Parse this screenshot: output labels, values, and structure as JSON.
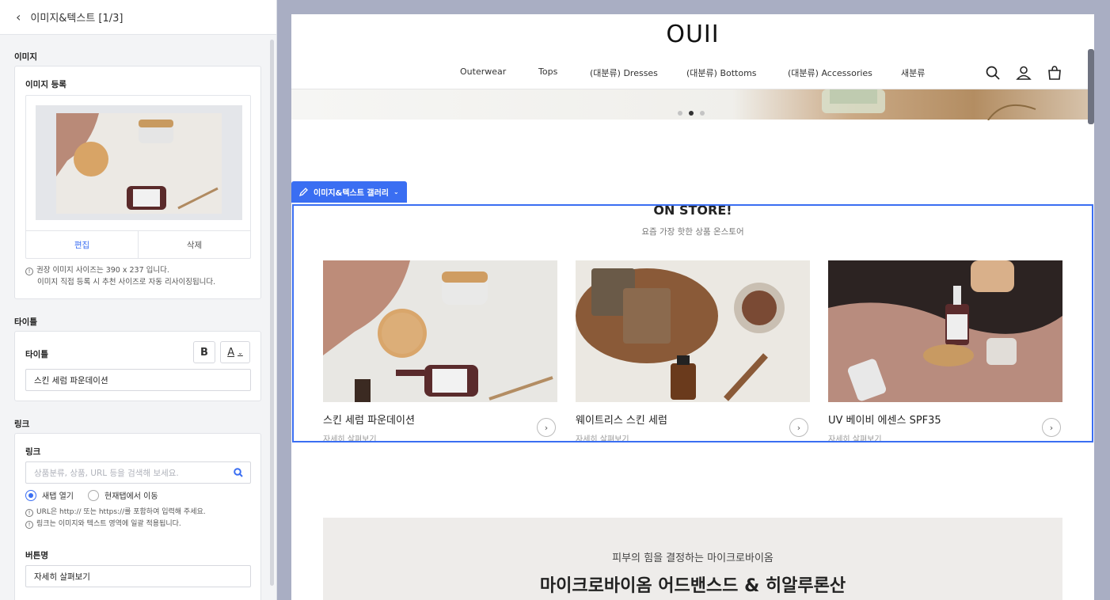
{
  "panel": {
    "header_title": "이미지&텍스트 [1/3]",
    "image_section": "이미지",
    "image_card_label": "이미지 등록",
    "edit_label": "편집",
    "delete_label": "삭제",
    "image_note_1": "권장 이미지 사이즈는 390 x 237 입니다.",
    "image_note_2": "이미지 직접 등록 시 추천 사이즈로 자동 리사이징됩니다.",
    "title_section": "타이틀",
    "title_card_label": "타이틀",
    "bold_label": "B",
    "color_label": "A",
    "title_value": "스킨 세럼 파운데이션",
    "link_section": "링크",
    "link_card_label": "링크",
    "link_placeholder": "상품분류, 상품, URL 등을 검색해 보세요.",
    "radio_new_tab": "새탭 열기",
    "radio_current_tab": "현재탭에서 이동",
    "link_note_1": "URL은 http:// 또는 https://를 포함하여 입력해 주세요.",
    "link_note_2": "링크는 이미지와 텍스트 영역에 일괄 적용됩니다.",
    "button_name_label": "버튼명",
    "button_name_value": "자세히 살펴보기"
  },
  "site": {
    "logo": "OUII",
    "nav": [
      "Outerwear",
      "Tops",
      "(대분류) Dresses",
      "(대분류) Bottoms",
      "(대분류) Accessories",
      "새분류"
    ],
    "editor_tab": "이미지&텍스트 갤러리",
    "gallery_title": "ON STORE!",
    "gallery_subtitle": "요즘 가장 핫한 상품 온스토어",
    "items": [
      {
        "title": "스킨 세럼 파운데이션",
        "link": "자세히 살펴보기"
      },
      {
        "title": "웨이트리스 스킨 세럼",
        "link": "자세히 살펴보기"
      },
      {
        "title": "UV 베이비 에센스 SPF35",
        "link": "자세히 살펴보기"
      }
    ],
    "promo_subtitle": "피부의 힘을 결정하는 마이크로바이옴",
    "promo_title": "마이크로바이옴 어드밴스드 & 히알루론산"
  },
  "colors": {
    "accent": "#3a6ef2",
    "background": "#a9aec3"
  }
}
